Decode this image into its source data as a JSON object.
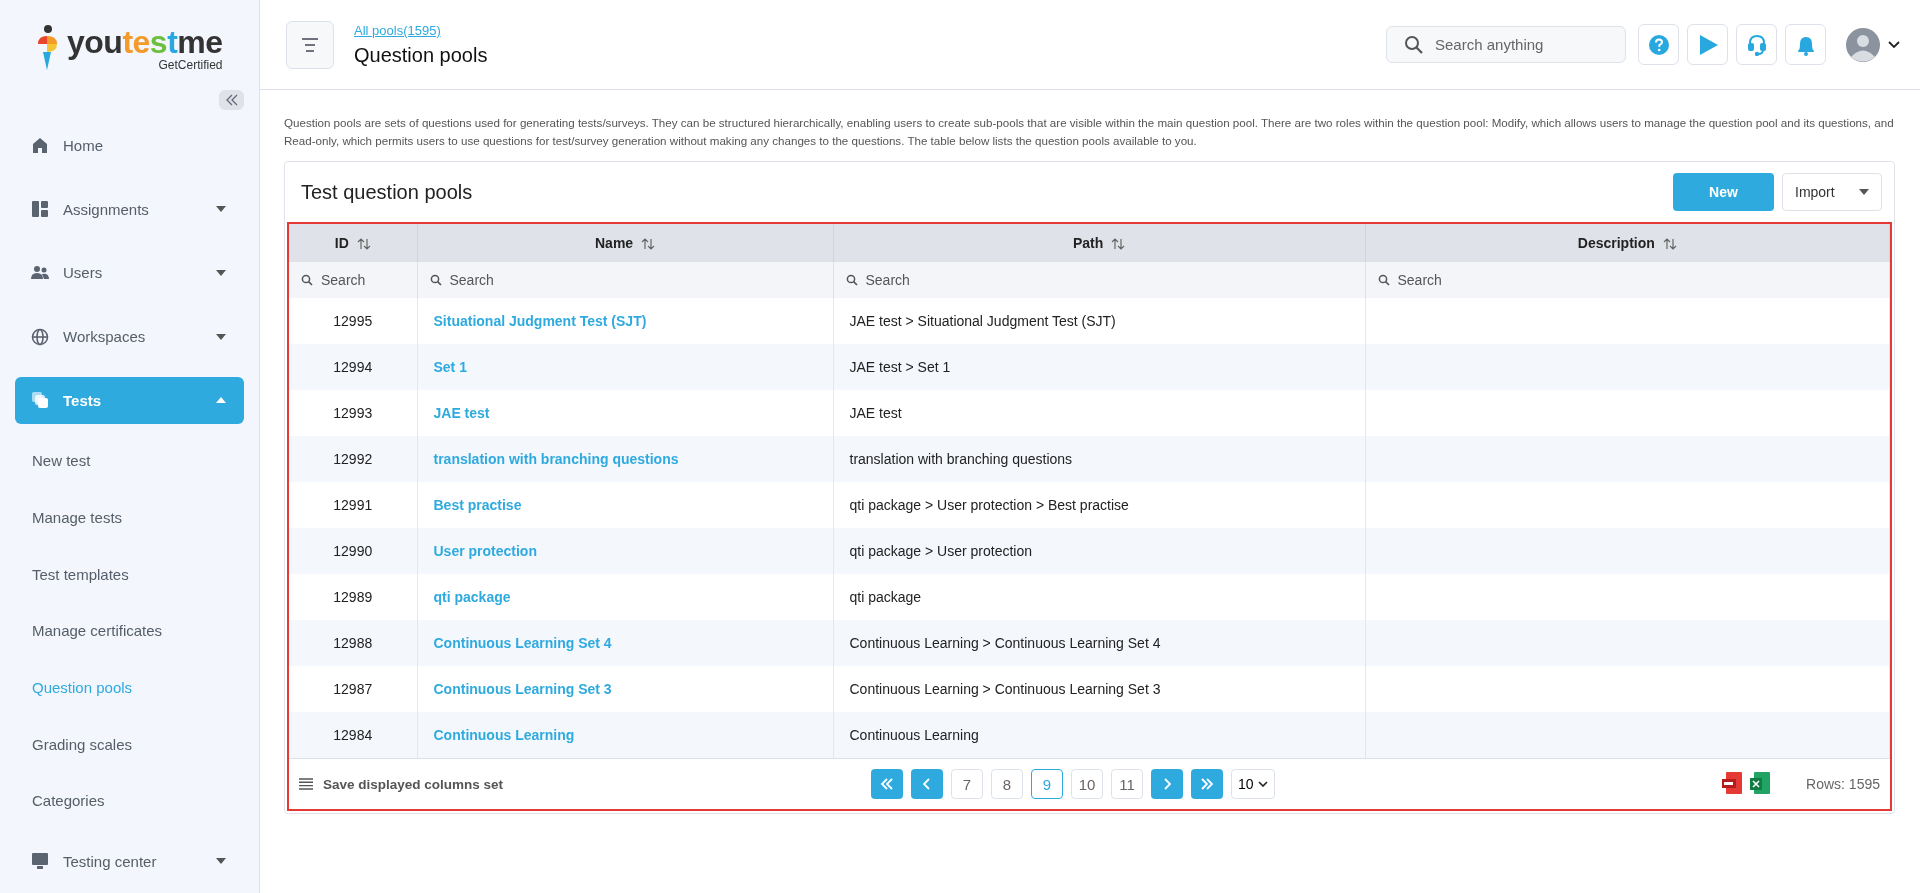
{
  "logo": {
    "parts": [
      {
        "text": "you",
        "color": "#333333"
      },
      {
        "text": "te",
        "color": "#f39a2b"
      },
      {
        "text": "s",
        "color": "#6cbf3f"
      },
      {
        "text": "t",
        "color": "#29a8e0"
      },
      {
        "text": "me",
        "color": "#333333"
      }
    ],
    "tagline": "GetCertified"
  },
  "sidebar": {
    "items": [
      {
        "label": "Home",
        "selected": false,
        "has_menu": false,
        "expanded": false
      },
      {
        "label": "Assignments",
        "selected": false,
        "has_menu": true,
        "expanded": false
      },
      {
        "label": "Users",
        "selected": false,
        "has_menu": true,
        "expanded": false
      },
      {
        "label": "Workspaces",
        "selected": false,
        "has_menu": true,
        "expanded": false
      },
      {
        "label": "Tests",
        "selected": true,
        "has_menu": true,
        "expanded": true,
        "children": [
          {
            "label": "New test",
            "selected": false
          },
          {
            "label": "Manage tests",
            "selected": false
          },
          {
            "label": "Test templates",
            "selected": false
          },
          {
            "label": "Manage certificates",
            "selected": false
          },
          {
            "label": "Question pools",
            "selected": true
          },
          {
            "label": "Grading scales",
            "selected": false
          },
          {
            "label": "Categories",
            "selected": false
          }
        ]
      },
      {
        "label": "Testing center",
        "selected": false,
        "has_menu": true,
        "expanded": false
      }
    ]
  },
  "header": {
    "breadcrumb": "All pools(1595)",
    "title": "Question pools",
    "search": {
      "placeholder": "Search anything"
    }
  },
  "description": "Question pools are sets of questions used for generating tests/surveys. They can be structured hierarchically, enabling users to create sub-pools that are visible within the main question pool. There are two roles within the question pool: Modify, which allows users to manage the question pool and its questions, and Read-only, which permits users to use questions for test/survey generation without making any changes to the questions. The table below lists the question pools available to you.",
  "card": {
    "title": "Test question pools",
    "new_button": "New",
    "import_button": "Import"
  },
  "table": {
    "columns": [
      {
        "label": "ID",
        "filter_placeholder": "Search"
      },
      {
        "label": "Name",
        "filter_placeholder": "Search"
      },
      {
        "label": "Path",
        "filter_placeholder": "Search"
      },
      {
        "label": "Description",
        "filter_placeholder": "Search"
      }
    ],
    "rows": [
      {
        "id": "12995",
        "name": "Situational Judgment Test (SJT)",
        "path": "JAE test > Situational Judgment Test (SJT)"
      },
      {
        "id": "12994",
        "name": "Set 1",
        "path": "JAE test > Set 1"
      },
      {
        "id": "12993",
        "name": "JAE test",
        "path": "JAE test"
      },
      {
        "id": "12992",
        "name": "translation with branching questions",
        "path": "translation with branching questions"
      },
      {
        "id": "12991",
        "name": "Best practise",
        "path": "qti package > User protection > Best practise"
      },
      {
        "id": "12990",
        "name": "User protection",
        "path": "qti package > User protection"
      },
      {
        "id": "12989",
        "name": "qti package",
        "path": "qti package"
      },
      {
        "id": "12988",
        "name": "Continuous Learning Set 4",
        "path": "Continuous Learning > Continuous Learning Set 4"
      },
      {
        "id": "12987",
        "name": "Continuous Learning Set 3",
        "path": "Continuous Learning > Continuous Learning Set 3"
      },
      {
        "id": "12984",
        "name": "Continuous Learning",
        "path": "Continuous Learning"
      }
    ]
  },
  "footer": {
    "save_columns": "Save displayed columns set",
    "pages": [
      {
        "label": "7",
        "selected": false
      },
      {
        "label": "8",
        "selected": false
      },
      {
        "label": "9",
        "selected": true
      },
      {
        "label": "10",
        "selected": false
      },
      {
        "label": "11",
        "selected": false
      }
    ],
    "page_size": "10",
    "rows_count": "Rows: 1595"
  }
}
